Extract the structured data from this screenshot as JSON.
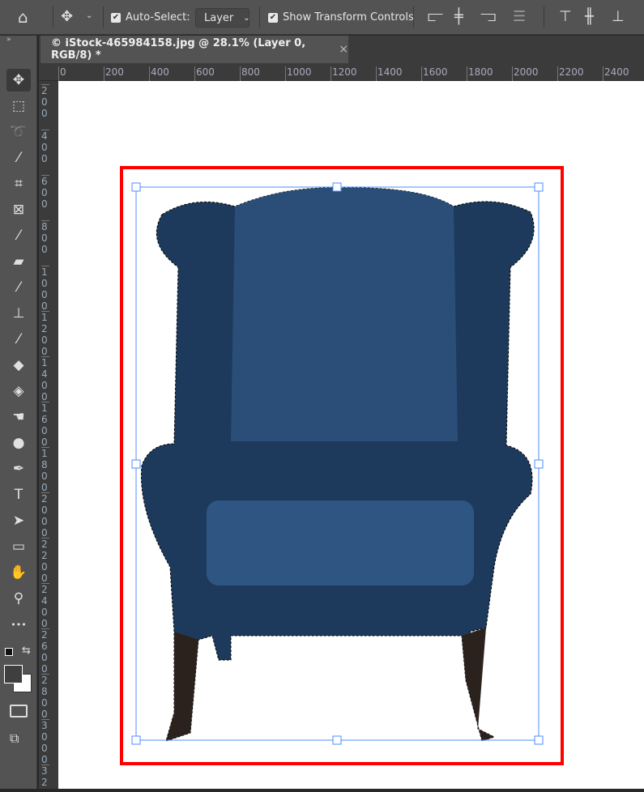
{
  "options_bar": {
    "auto_select_label": "Auto-Select:",
    "auto_select_checked": true,
    "auto_select_target": "Layer",
    "show_transform_label": "Show Transform Controls",
    "show_transform_checked": true
  },
  "document_tab": {
    "title": "© iStock-465984158.jpg @ 28.1% (Layer 0, RGB/8) *",
    "close": "×"
  },
  "rulers": {
    "horizontal": [
      "0",
      "200",
      "400",
      "600",
      "800",
      "1000",
      "1200",
      "1400",
      "1600",
      "1800",
      "2000",
      "2200",
      "2400"
    ],
    "vertical": [
      "200",
      "400",
      "600",
      "800",
      "1000",
      "1200",
      "1400",
      "1600",
      "1800",
      "2000",
      "2200",
      "2400",
      "2600",
      "2800",
      "3000",
      "32"
    ]
  },
  "tools": [
    {
      "name": "move",
      "glyph": "✥"
    },
    {
      "name": "rectangular-marquee",
      "glyph": "⬚"
    },
    {
      "name": "lasso",
      "glyph": "➰"
    },
    {
      "name": "magic-wand",
      "glyph": "⁄"
    },
    {
      "name": "crop",
      "glyph": "⌗"
    },
    {
      "name": "frame",
      "glyph": "⊠"
    },
    {
      "name": "eyedropper",
      "glyph": "⁄"
    },
    {
      "name": "healing-brush",
      "glyph": "▰"
    },
    {
      "name": "brush",
      "glyph": "⁄"
    },
    {
      "name": "clone-stamp",
      "glyph": "⊥"
    },
    {
      "name": "history-brush",
      "glyph": "⁄"
    },
    {
      "name": "eraser",
      "glyph": "◆"
    },
    {
      "name": "paint-bucket",
      "glyph": "◈"
    },
    {
      "name": "smudge",
      "glyph": "☚"
    },
    {
      "name": "dodge",
      "glyph": "●"
    },
    {
      "name": "pen",
      "glyph": "✒"
    },
    {
      "name": "type",
      "glyph": "T"
    },
    {
      "name": "path-selection",
      "glyph": "➤"
    },
    {
      "name": "rectangle",
      "glyph": "▭"
    },
    {
      "name": "hand",
      "glyph": "✋"
    },
    {
      "name": "zoom",
      "glyph": "⚲"
    },
    {
      "name": "more",
      "glyph": "•••"
    }
  ],
  "colors": {
    "foreground": "#3f3f3f",
    "background": "#ffffff",
    "selection_outline": "#ff0000",
    "transform_box": "#4d8cff",
    "chair": "#1d3a5c"
  }
}
